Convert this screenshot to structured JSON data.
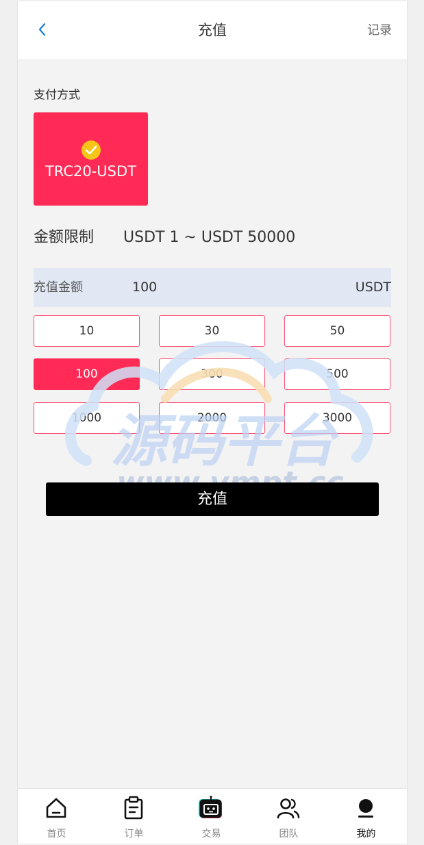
{
  "header": {
    "title": "充值",
    "record_label": "记录"
  },
  "payment": {
    "section_label": "支付方式",
    "method_name": "TRC20-USDT",
    "check_color": "#f5c518",
    "card_color": "#ff2a55"
  },
  "limit": {
    "label": "金额限制",
    "range": "USDT 1 ~ USDT 50000"
  },
  "amount": {
    "label": "充值金额",
    "value": "100",
    "unit": "USDT"
  },
  "presets": [
    "10",
    "30",
    "50",
    "100",
    "300",
    "500",
    "1000",
    "2000",
    "3000"
  ],
  "selected_preset": "100",
  "submit_label": "充值",
  "watermark": {
    "main_text": "源码平台",
    "url_text": "www.vmpt.cc"
  },
  "tabs": [
    {
      "label": "首页",
      "icon": "home-icon"
    },
    {
      "label": "订单",
      "icon": "clipboard-icon"
    },
    {
      "label": "交易",
      "icon": "robot-icon"
    },
    {
      "label": "团队",
      "icon": "team-icon"
    },
    {
      "label": "我的",
      "icon": "user-icon"
    }
  ],
  "active_tab": "我的",
  "colors": {
    "accent": "#ff2a55",
    "button": "#000000",
    "amount_row_bg": "#e1e8f4",
    "back_arrow": "#1a7fd6"
  }
}
